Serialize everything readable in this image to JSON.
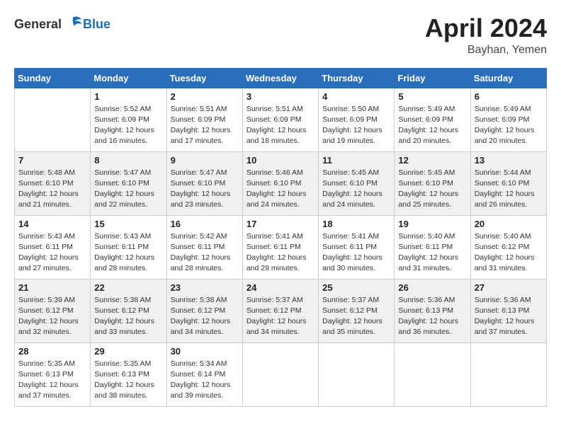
{
  "logo": {
    "general": "General",
    "blue": "Blue"
  },
  "title": {
    "month": "April 2024",
    "location": "Bayhan, Yemen"
  },
  "headers": [
    "Sunday",
    "Monday",
    "Tuesday",
    "Wednesday",
    "Thursday",
    "Friday",
    "Saturday"
  ],
  "weeks": [
    [
      {
        "day": "",
        "sunrise": "",
        "sunset": "",
        "daylight": "",
        "empty": true
      },
      {
        "day": "1",
        "sunrise": "Sunrise: 5:52 AM",
        "sunset": "Sunset: 6:09 PM",
        "daylight": "Daylight: 12 hours and 16 minutes."
      },
      {
        "day": "2",
        "sunrise": "Sunrise: 5:51 AM",
        "sunset": "Sunset: 6:09 PM",
        "daylight": "Daylight: 12 hours and 17 minutes."
      },
      {
        "day": "3",
        "sunrise": "Sunrise: 5:51 AM",
        "sunset": "Sunset: 6:09 PM",
        "daylight": "Daylight: 12 hours and 18 minutes."
      },
      {
        "day": "4",
        "sunrise": "Sunrise: 5:50 AM",
        "sunset": "Sunset: 6:09 PM",
        "daylight": "Daylight: 12 hours and 19 minutes."
      },
      {
        "day": "5",
        "sunrise": "Sunrise: 5:49 AM",
        "sunset": "Sunset: 6:09 PM",
        "daylight": "Daylight: 12 hours and 20 minutes."
      },
      {
        "day": "6",
        "sunrise": "Sunrise: 5:49 AM",
        "sunset": "Sunset: 6:09 PM",
        "daylight": "Daylight: 12 hours and 20 minutes."
      }
    ],
    [
      {
        "day": "7",
        "sunrise": "Sunrise: 5:48 AM",
        "sunset": "Sunset: 6:10 PM",
        "daylight": "Daylight: 12 hours and 21 minutes."
      },
      {
        "day": "8",
        "sunrise": "Sunrise: 5:47 AM",
        "sunset": "Sunset: 6:10 PM",
        "daylight": "Daylight: 12 hours and 22 minutes."
      },
      {
        "day": "9",
        "sunrise": "Sunrise: 5:47 AM",
        "sunset": "Sunset: 6:10 PM",
        "daylight": "Daylight: 12 hours and 23 minutes."
      },
      {
        "day": "10",
        "sunrise": "Sunrise: 5:46 AM",
        "sunset": "Sunset: 6:10 PM",
        "daylight": "Daylight: 12 hours and 24 minutes."
      },
      {
        "day": "11",
        "sunrise": "Sunrise: 5:45 AM",
        "sunset": "Sunset: 6:10 PM",
        "daylight": "Daylight: 12 hours and 24 minutes."
      },
      {
        "day": "12",
        "sunrise": "Sunrise: 5:45 AM",
        "sunset": "Sunset: 6:10 PM",
        "daylight": "Daylight: 12 hours and 25 minutes."
      },
      {
        "day": "13",
        "sunrise": "Sunrise: 5:44 AM",
        "sunset": "Sunset: 6:10 PM",
        "daylight": "Daylight: 12 hours and 26 minutes."
      }
    ],
    [
      {
        "day": "14",
        "sunrise": "Sunrise: 5:43 AM",
        "sunset": "Sunset: 6:11 PM",
        "daylight": "Daylight: 12 hours and 27 minutes."
      },
      {
        "day": "15",
        "sunrise": "Sunrise: 5:43 AM",
        "sunset": "Sunset: 6:11 PM",
        "daylight": "Daylight: 12 hours and 28 minutes."
      },
      {
        "day": "16",
        "sunrise": "Sunrise: 5:42 AM",
        "sunset": "Sunset: 6:11 PM",
        "daylight": "Daylight: 12 hours and 28 minutes."
      },
      {
        "day": "17",
        "sunrise": "Sunrise: 5:41 AM",
        "sunset": "Sunset: 6:11 PM",
        "daylight": "Daylight: 12 hours and 29 minutes."
      },
      {
        "day": "18",
        "sunrise": "Sunrise: 5:41 AM",
        "sunset": "Sunset: 6:11 PM",
        "daylight": "Daylight: 12 hours and 30 minutes."
      },
      {
        "day": "19",
        "sunrise": "Sunrise: 5:40 AM",
        "sunset": "Sunset: 6:11 PM",
        "daylight": "Daylight: 12 hours and 31 minutes."
      },
      {
        "day": "20",
        "sunrise": "Sunrise: 5:40 AM",
        "sunset": "Sunset: 6:12 PM",
        "daylight": "Daylight: 12 hours and 31 minutes."
      }
    ],
    [
      {
        "day": "21",
        "sunrise": "Sunrise: 5:39 AM",
        "sunset": "Sunset: 6:12 PM",
        "daylight": "Daylight: 12 hours and 32 minutes."
      },
      {
        "day": "22",
        "sunrise": "Sunrise: 5:38 AM",
        "sunset": "Sunset: 6:12 PM",
        "daylight": "Daylight: 12 hours and 33 minutes."
      },
      {
        "day": "23",
        "sunrise": "Sunrise: 5:38 AM",
        "sunset": "Sunset: 6:12 PM",
        "daylight": "Daylight: 12 hours and 34 minutes."
      },
      {
        "day": "24",
        "sunrise": "Sunrise: 5:37 AM",
        "sunset": "Sunset: 6:12 PM",
        "daylight": "Daylight: 12 hours and 34 minutes."
      },
      {
        "day": "25",
        "sunrise": "Sunrise: 5:37 AM",
        "sunset": "Sunset: 6:12 PM",
        "daylight": "Daylight: 12 hours and 35 minutes."
      },
      {
        "day": "26",
        "sunrise": "Sunrise: 5:36 AM",
        "sunset": "Sunset: 6:13 PM",
        "daylight": "Daylight: 12 hours and 36 minutes."
      },
      {
        "day": "27",
        "sunrise": "Sunrise: 5:36 AM",
        "sunset": "Sunset: 6:13 PM",
        "daylight": "Daylight: 12 hours and 37 minutes."
      }
    ],
    [
      {
        "day": "28",
        "sunrise": "Sunrise: 5:35 AM",
        "sunset": "Sunset: 6:13 PM",
        "daylight": "Daylight: 12 hours and 37 minutes."
      },
      {
        "day": "29",
        "sunrise": "Sunrise: 5:35 AM",
        "sunset": "Sunset: 6:13 PM",
        "daylight": "Daylight: 12 hours and 38 minutes."
      },
      {
        "day": "30",
        "sunrise": "Sunrise: 5:34 AM",
        "sunset": "Sunset: 6:14 PM",
        "daylight": "Daylight: 12 hours and 39 minutes."
      },
      {
        "day": "",
        "sunrise": "",
        "sunset": "",
        "daylight": "",
        "empty": true
      },
      {
        "day": "",
        "sunrise": "",
        "sunset": "",
        "daylight": "",
        "empty": true
      },
      {
        "day": "",
        "sunrise": "",
        "sunset": "",
        "daylight": "",
        "empty": true
      },
      {
        "day": "",
        "sunrise": "",
        "sunset": "",
        "daylight": "",
        "empty": true
      }
    ]
  ]
}
